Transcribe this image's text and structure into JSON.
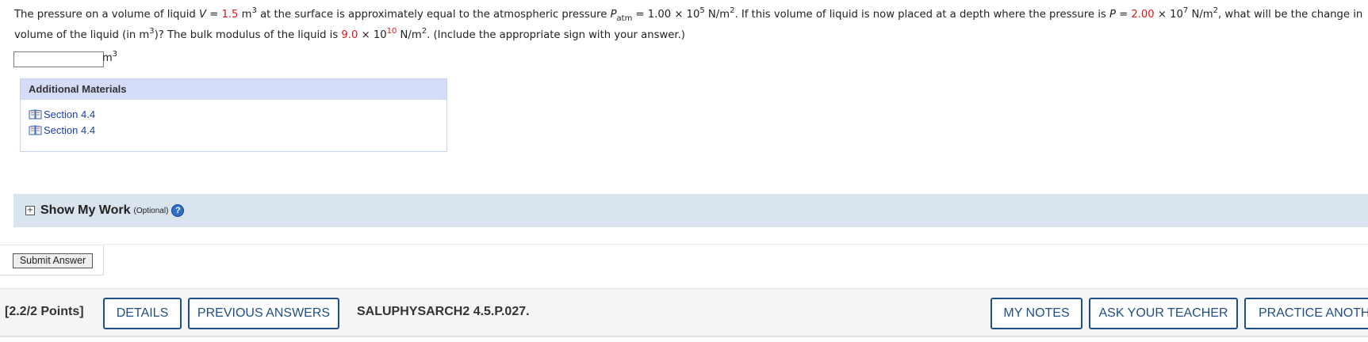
{
  "question": {
    "p1": "The pressure on a volume of liquid ",
    "v_var": "V",
    "eq1": " = ",
    "v_val": "1.5",
    "v_unit": " m",
    "v_exp": "3",
    "p2": " at the surface is approximately equal to the atmospheric pressure ",
    "patm_var": "P",
    "patm_sub": "atm",
    "patm_eq": " = 1.00 × 10",
    "patm_exp": "5",
    "patm_unit": " N/m",
    "patm_unit_exp": "2",
    "p3": ". If this volume of liquid is now placed at a depth where the pressure is ",
    "p_var": "P",
    "p_eq": " = ",
    "p_val": "2.00",
    "p_times": " × 10",
    "p_exp": "7",
    "p_unit": " N/m",
    "p_unit_exp": "2",
    "p4": ", what will be the change in",
    "line2_a": "volume of the liquid (in m",
    "line2_exp": "3",
    "line2_b": ")? The bulk modulus of the liquid is ",
    "b_val": "9.0",
    "b_times": " × 10",
    "b_exp": "10",
    "b_unit": " N/m",
    "b_unit_exp": "2",
    "line2_c": ". (Include the appropriate sign with your answer.)"
  },
  "answer": {
    "value": "",
    "placeholder": "",
    "unit": "m",
    "unit_exp": "3"
  },
  "materials": {
    "title": "Additional Materials",
    "links": [
      {
        "label": "Section 4.4",
        "icon": "book-icon"
      },
      {
        "label": "Section 4.4",
        "icon": "book-icon"
      }
    ]
  },
  "show_work": {
    "expand_symbol": "+",
    "title": "Show My Work",
    "optional": "(Optional)",
    "help_symbol": "?"
  },
  "submit": {
    "label": "Submit Answer"
  },
  "footer": {
    "points": "[2.2/2 Points]",
    "details": "DETAILS",
    "previous_answers": "PREVIOUS ANSWERS",
    "question_id": "SALUPHYSARCH2 4.5.P.027.",
    "my_notes": "MY NOTES",
    "ask_teacher": "ASK YOUR TEACHER",
    "practice": "PRACTICE ANOTHER"
  },
  "colors": {
    "given_value": "#e0161b",
    "link": "#1c3faa",
    "button_border": "#1f4f86",
    "materials_header": "#d4dcf7",
    "show_work_bg": "#dae4ef"
  }
}
